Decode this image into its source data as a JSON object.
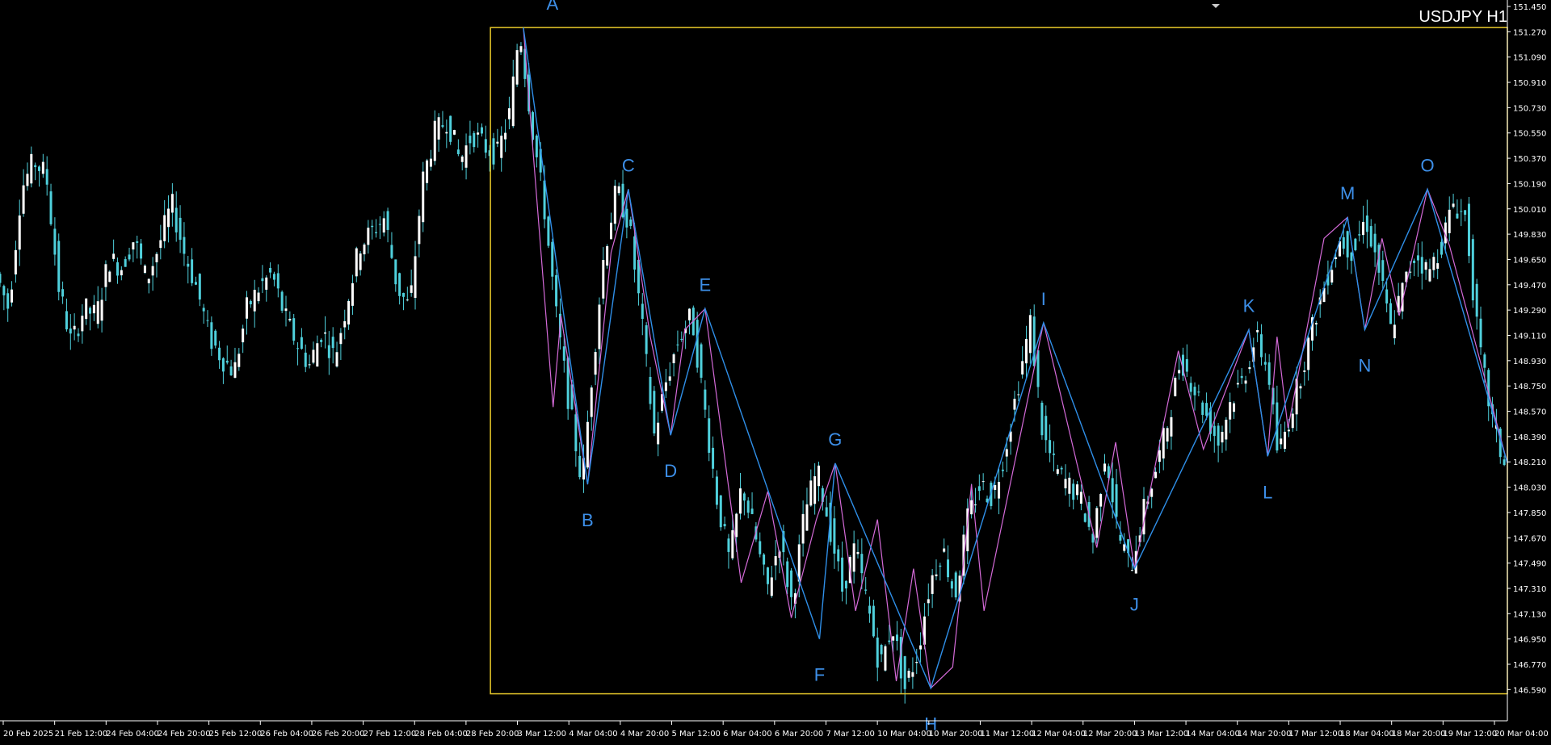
{
  "symbol_title": "USDJPY H1",
  "colors": {
    "background": "#000000",
    "candle": "#4fd0dc",
    "candle_body_alt": "#ffffff",
    "wave_primary": "#2f8fe8",
    "wave_secondary": "#d46ad8",
    "selection_box": "#e8c92a",
    "axis": "#ffffff",
    "label": "#3d8fe8"
  },
  "chart_data": {
    "type": "candlestick",
    "title": "USDJPY H1",
    "ylim": [
      146.5,
      151.45
    ],
    "price_ticks": [
      "151.450",
      "151.270",
      "151.090",
      "150.910",
      "150.730",
      "150.550",
      "150.370",
      "150.190",
      "150.010",
      "149.830",
      "149.650",
      "149.470",
      "149.290",
      "149.110",
      "148.930",
      "148.750",
      "148.570",
      "148.390",
      "148.210",
      "148.030",
      "147.850",
      "147.670",
      "147.490",
      "147.310",
      "147.130",
      "146.950",
      "146.770",
      "146.590"
    ],
    "time_ticks": [
      "20 Feb 2025",
      "21 Feb 12:00",
      "24 Feb 04:00",
      "24 Feb 20:00",
      "25 Feb 12:00",
      "26 Feb 04:00",
      "26 Feb 20:00",
      "27 Feb 12:00",
      "28 Feb 04:00",
      "28 Feb 20:00",
      "3 Mar 12:00",
      "4 Mar 04:00",
      "4 Mar 20:00",
      "5 Mar 12:00",
      "6 Mar 04:00",
      "6 Mar 20:00",
      "7 Mar 12:00",
      "10 Mar 04:00",
      "10 Mar 20:00",
      "11 Mar 12:00",
      "12 Mar 04:00",
      "12 Mar 20:00",
      "13 Mar 12:00",
      "14 Mar 04:00",
      "14 Mar 20:00",
      "17 Mar 12:00",
      "18 Mar 04:00",
      "18 Mar 20:00",
      "19 Mar 12:00",
      "20 Mar 04:00"
    ],
    "close_path": [
      [
        0,
        149.55
      ],
      [
        8,
        149.3
      ],
      [
        16,
        150.15
      ],
      [
        24,
        150.35
      ],
      [
        32,
        150.25
      ],
      [
        40,
        149.45
      ],
      [
        48,
        149.05
      ],
      [
        56,
        149.3
      ],
      [
        64,
        149.25
      ],
      [
        72,
        149.65
      ],
      [
        80,
        149.6
      ],
      [
        88,
        149.8
      ],
      [
        96,
        149.5
      ],
      [
        104,
        149.75
      ],
      [
        112,
        150.05
      ],
      [
        120,
        149.7
      ],
      [
        128,
        149.45
      ],
      [
        136,
        149.1
      ],
      [
        144,
        148.95
      ],
      [
        152,
        148.85
      ],
      [
        160,
        149.3
      ],
      [
        168,
        149.45
      ],
      [
        176,
        149.55
      ],
      [
        184,
        149.25
      ],
      [
        192,
        149.05
      ],
      [
        200,
        148.9
      ],
      [
        208,
        149.15
      ],
      [
        216,
        148.95
      ],
      [
        224,
        149.35
      ],
      [
        232,
        149.75
      ],
      [
        240,
        149.85
      ],
      [
        248,
        149.95
      ],
      [
        256,
        149.45
      ],
      [
        264,
        149.3
      ],
      [
        272,
        150.2
      ],
      [
        280,
        150.55
      ],
      [
        288,
        150.65
      ],
      [
        296,
        150.35
      ],
      [
        304,
        150.55
      ],
      [
        312,
        150.45
      ],
      [
        320,
        150.4
      ],
      [
        328,
        150.7
      ],
      [
        334,
        151.3
      ],
      [
        342,
        150.6
      ],
      [
        350,
        150.0
      ],
      [
        358,
        149.2
      ],
      [
        366,
        148.6
      ],
      [
        374,
        148.05
      ],
      [
        380,
        148.8
      ],
      [
        388,
        149.7
      ],
      [
        396,
        150.15
      ],
      [
        404,
        149.9
      ],
      [
        412,
        149.2
      ],
      [
        420,
        148.4
      ],
      [
        428,
        148.8
      ],
      [
        436,
        149.1
      ],
      [
        444,
        149.25
      ],
      [
        452,
        148.6
      ],
      [
        460,
        147.95
      ],
      [
        468,
        147.5
      ],
      [
        476,
        148.05
      ],
      [
        484,
        147.7
      ],
      [
        492,
        147.3
      ],
      [
        500,
        147.65
      ],
      [
        508,
        147.2
      ],
      [
        516,
        147.85
      ],
      [
        524,
        148.15
      ],
      [
        532,
        147.75
      ],
      [
        540,
        147.3
      ],
      [
        548,
        147.6
      ],
      [
        556,
        147.2
      ],
      [
        564,
        146.75
      ],
      [
        572,
        147.05
      ],
      [
        580,
        146.6
      ],
      [
        588,
        146.85
      ],
      [
        596,
        147.35
      ],
      [
        604,
        147.6
      ],
      [
        612,
        147.25
      ],
      [
        620,
        147.8
      ],
      [
        628,
        148.05
      ],
      [
        636,
        147.95
      ],
      [
        644,
        148.3
      ],
      [
        652,
        148.75
      ],
      [
        660,
        149.2
      ],
      [
        668,
        148.4
      ],
      [
        676,
        148.15
      ],
      [
        684,
        148.05
      ],
      [
        692,
        147.95
      ],
      [
        700,
        147.65
      ],
      [
        708,
        148.3
      ],
      [
        716,
        147.7
      ],
      [
        724,
        147.45
      ],
      [
        732,
        147.85
      ],
      [
        740,
        148.15
      ],
      [
        748,
        148.5
      ],
      [
        756,
        148.95
      ],
      [
        764,
        148.75
      ],
      [
        772,
        148.55
      ],
      [
        780,
        148.35
      ],
      [
        788,
        148.65
      ],
      [
        796,
        148.8
      ],
      [
        804,
        149.1
      ],
      [
        812,
        148.85
      ],
      [
        818,
        148.25
      ],
      [
        826,
        148.55
      ],
      [
        834,
        148.9
      ],
      [
        842,
        149.25
      ],
      [
        850,
        149.55
      ],
      [
        858,
        149.8
      ],
      [
        866,
        149.7
      ],
      [
        874,
        149.95
      ],
      [
        882,
        149.6
      ],
      [
        890,
        149.15
      ],
      [
        898,
        149.45
      ],
      [
        906,
        149.7
      ],
      [
        914,
        149.55
      ],
      [
        922,
        149.75
      ],
      [
        930,
        150.05
      ],
      [
        938,
        149.95
      ],
      [
        946,
        149.05
      ],
      [
        954,
        148.55
      ],
      [
        962,
        148.2
      ]
    ],
    "history_window": {
      "x_from": 0,
      "x_to": 962
    },
    "wave_points": [
      {
        "label": "A",
        "x": 334,
        "price": 151.3
      },
      {
        "label": "B",
        "x": 375,
        "price": 148.05
      },
      {
        "label": "C",
        "x": 401,
        "price": 150.15
      },
      {
        "label": "D",
        "x": 428,
        "price": 148.4
      },
      {
        "label": "E",
        "x": 450,
        "price": 149.3
      },
      {
        "label": "F",
        "x": 523,
        "price": 146.95
      },
      {
        "label": "G",
        "x": 533,
        "price": 148.2
      },
      {
        "label": "H",
        "x": 594,
        "price": 146.6
      },
      {
        "label": "I",
        "x": 666,
        "price": 149.2
      },
      {
        "label": "J",
        "x": 724,
        "price": 147.45
      },
      {
        "label": "K",
        "x": 797,
        "price": 149.15
      },
      {
        "label": "L",
        "x": 809,
        "price": 148.25
      },
      {
        "label": "M",
        "x": 860,
        "price": 149.95
      },
      {
        "label": "N",
        "x": 871,
        "price": 149.15
      },
      {
        "label": "O",
        "x": 911,
        "price": 150.15
      },
      {
        "label": "",
        "x": 962,
        "price": 148.2
      }
    ],
    "secondary_points": [
      {
        "x": 334,
        "price": 151.3
      },
      {
        "x": 353,
        "price": 148.6
      },
      {
        "x": 358,
        "price": 149.25
      },
      {
        "x": 375,
        "price": 148.05
      },
      {
        "x": 390,
        "price": 149.7
      },
      {
        "x": 401,
        "price": 150.15
      },
      {
        "x": 415,
        "price": 149.1
      },
      {
        "x": 428,
        "price": 148.4
      },
      {
        "x": 437,
        "price": 149.15
      },
      {
        "x": 450,
        "price": 149.3
      },
      {
        "x": 473,
        "price": 147.35
      },
      {
        "x": 490,
        "price": 148.0
      },
      {
        "x": 505,
        "price": 147.1
      },
      {
        "x": 521,
        "price": 147.8
      },
      {
        "x": 533,
        "price": 148.2
      },
      {
        "x": 546,
        "price": 147.15
      },
      {
        "x": 560,
        "price": 147.8
      },
      {
        "x": 572,
        "price": 146.65
      },
      {
        "x": 583,
        "price": 147.45
      },
      {
        "x": 594,
        "price": 146.6
      },
      {
        "x": 608,
        "price": 146.75
      },
      {
        "x": 620,
        "price": 148.05
      },
      {
        "x": 628,
        "price": 147.15
      },
      {
        "x": 666,
        "price": 149.2
      },
      {
        "x": 700,
        "price": 147.6
      },
      {
        "x": 712,
        "price": 148.35
      },
      {
        "x": 724,
        "price": 147.45
      },
      {
        "x": 752,
        "price": 149.0
      },
      {
        "x": 768,
        "price": 148.3
      },
      {
        "x": 797,
        "price": 149.15
      },
      {
        "x": 809,
        "price": 148.25
      },
      {
        "x": 815,
        "price": 149.1
      },
      {
        "x": 822,
        "price": 148.45
      },
      {
        "x": 845,
        "price": 149.8
      },
      {
        "x": 860,
        "price": 149.95
      },
      {
        "x": 871,
        "price": 149.15
      },
      {
        "x": 882,
        "price": 149.8
      },
      {
        "x": 893,
        "price": 149.25
      },
      {
        "x": 911,
        "price": 150.15
      },
      {
        "x": 925,
        "price": 149.75
      },
      {
        "x": 962,
        "price": 148.2
      }
    ],
    "selection_box": {
      "x_from": 313,
      "x_to": 962,
      "price_top": 151.3,
      "price_bottom": 146.56
    },
    "grid": false,
    "legend": "none"
  }
}
